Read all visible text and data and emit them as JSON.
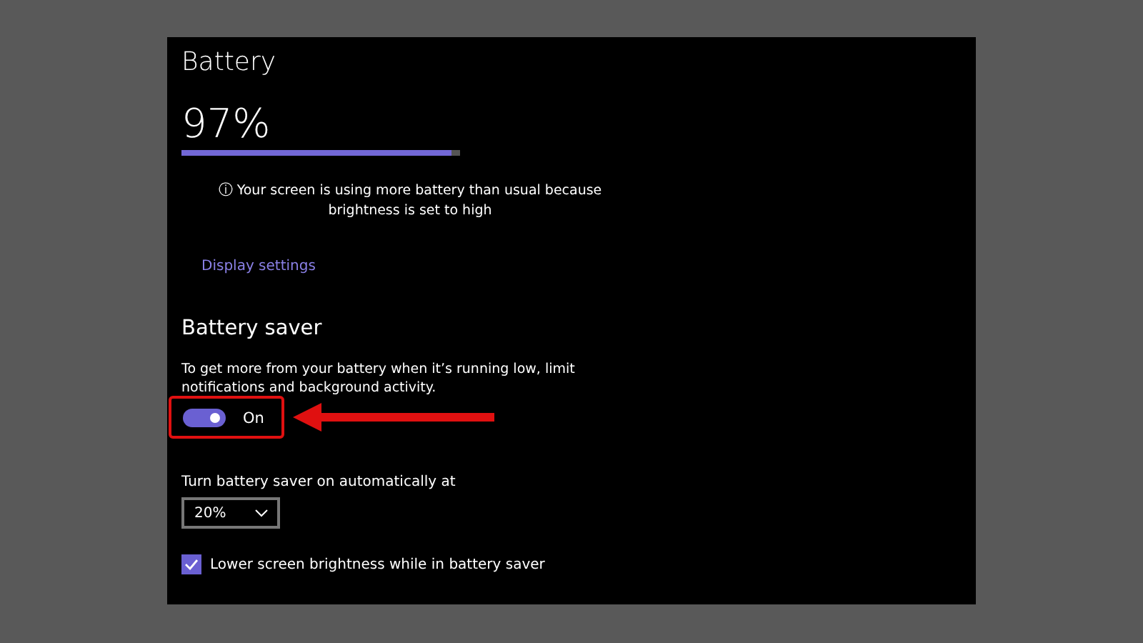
{
  "title": "Battery",
  "battery": {
    "percent": "97%",
    "level": 0.97
  },
  "notice": {
    "icon": "ⓘ",
    "text": "Your screen is using more battery than usual because brightness is set to high"
  },
  "display_link": "Display settings",
  "saver": {
    "heading": "Battery saver",
    "description": "To get more from your battery when it’s running low, limit notifications and background activity.",
    "toggle": {
      "on": true,
      "label": "On"
    }
  },
  "auto": {
    "label": "Turn battery saver on automatically at",
    "value": "20%"
  },
  "brightness_option": {
    "label": "Lower screen brightness while in battery saver",
    "checked": true
  }
}
